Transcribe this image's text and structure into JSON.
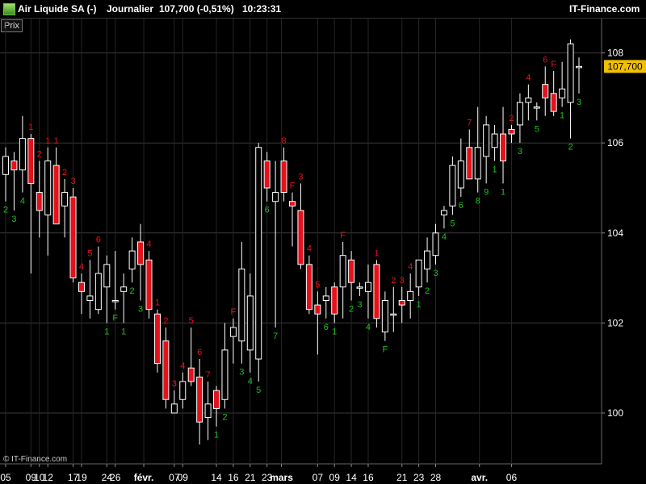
{
  "header": {
    "instrument": "Air Liquide SA (-)",
    "period": "Journalier",
    "price_change": "107,700 (-0,51%)",
    "time": "10:23:31",
    "brand": "IT-Finance.com"
  },
  "panel_label": "Prix",
  "copyright": "© IT-Finance.com",
  "colors": {
    "up": "#ffffff",
    "down": "#e4121b",
    "grid": "#3a3a3a",
    "label_up": "#1fbf1f",
    "label_down": "#e4121b",
    "last_price_bg": "#f0c000"
  },
  "chart_data": {
    "type": "candlestick",
    "y_range": [
      99.0,
      109.0
    ],
    "y_ticks": [
      "100",
      "102",
      "104",
      "106",
      "108"
    ],
    "last_price": "107,700",
    "x_ticks": [
      "05",
      "09",
      "10",
      "12",
      "17",
      "19",
      "24",
      "26",
      "févr.",
      "07",
      "09",
      "14",
      "16",
      "21",
      "23",
      "mars",
      "07",
      "09",
      "14",
      "16",
      "21",
      "23",
      "28",
      "avr.",
      "06"
    ],
    "candles": [
      {
        "o": 105.3,
        "h": 105.9,
        "l": 104.7,
        "c": 105.7,
        "label": "2",
        "lc": "up"
      },
      {
        "o": 105.6,
        "h": 105.8,
        "l": 104.5,
        "c": 105.4,
        "label": "3",
        "lc": "up"
      },
      {
        "o": 105.4,
        "h": 106.6,
        "l": 104.9,
        "c": 106.1,
        "label": "4",
        "lc": "up"
      },
      {
        "o": 106.1,
        "h": 106.2,
        "l": 103.1,
        "c": 105.1,
        "label": "1",
        "lc": "down"
      },
      {
        "o": 104.9,
        "h": 105.6,
        "l": 103.9,
        "c": 104.5,
        "label": "2",
        "lc": "down"
      },
      {
        "o": 104.4,
        "h": 105.9,
        "l": 103.5,
        "c": 105.6,
        "label": "1",
        "lc": "down"
      },
      {
        "o": 105.5,
        "h": 105.9,
        "l": 104.2,
        "c": 104.2,
        "label": "1",
        "lc": "down"
      },
      {
        "o": 104.6,
        "h": 105.2,
        "l": 103.9,
        "c": 104.9,
        "label": "2",
        "lc": "down"
      },
      {
        "o": 104.8,
        "h": 105.0,
        "l": 102.9,
        "c": 103.0,
        "label": "3",
        "lc": "down"
      },
      {
        "o": 102.9,
        "h": 103.1,
        "l": 102.2,
        "c": 102.7,
        "label": "4",
        "lc": "down"
      },
      {
        "o": 102.5,
        "h": 103.4,
        "l": 102.1,
        "c": 102.6,
        "label": "5",
        "lc": "down"
      },
      {
        "o": 102.3,
        "h": 103.7,
        "l": 102.2,
        "c": 103.1,
        "label": "6",
        "lc": "down"
      },
      {
        "o": 102.8,
        "h": 103.5,
        "l": 102.0,
        "c": 103.3,
        "label": "1",
        "lc": "up"
      },
      {
        "o": 102.5,
        "h": 103.6,
        "l": 102.3,
        "c": 102.5,
        "label": "F",
        "lc": "up"
      },
      {
        "o": 102.7,
        "h": 103.1,
        "l": 102.0,
        "c": 102.8,
        "label": "1",
        "lc": "up"
      },
      {
        "o": 103.2,
        "h": 103.9,
        "l": 102.9,
        "c": 103.6,
        "label": "2",
        "lc": "up"
      },
      {
        "o": 103.8,
        "h": 104.2,
        "l": 102.5,
        "c": 103.3,
        "label": "3",
        "lc": "up"
      },
      {
        "o": 103.4,
        "h": 103.6,
        "l": 102.1,
        "c": 102.3,
        "label": "4",
        "lc": "down"
      },
      {
        "o": 102.2,
        "h": 102.3,
        "l": 100.9,
        "c": 101.1,
        "label": "1",
        "lc": "down"
      },
      {
        "o": 101.6,
        "h": 101.9,
        "l": 100.1,
        "c": 100.3,
        "label": "2",
        "lc": "down"
      },
      {
        "o": 100.0,
        "h": 100.5,
        "l": 100.0,
        "c": 100.2,
        "label": "3",
        "lc": "down"
      },
      {
        "o": 100.3,
        "h": 100.9,
        "l": 100.1,
        "c": 100.7,
        "label": "4",
        "lc": "down"
      },
      {
        "o": 101.0,
        "h": 101.9,
        "l": 100.6,
        "c": 100.7,
        "label": "5",
        "lc": "down"
      },
      {
        "o": 100.8,
        "h": 101.2,
        "l": 99.3,
        "c": 99.8,
        "label": "6",
        "lc": "down"
      },
      {
        "o": 99.9,
        "h": 100.7,
        "l": 99.4,
        "c": 100.2,
        "label": "7",
        "lc": "down"
      },
      {
        "o": 100.5,
        "h": 100.6,
        "l": 99.7,
        "c": 100.1,
        "label": "1",
        "lc": "up"
      },
      {
        "o": 100.3,
        "h": 102.0,
        "l": 100.1,
        "c": 101.4,
        "label": "2",
        "lc": "up"
      },
      {
        "o": 101.7,
        "h": 102.1,
        "l": 101.1,
        "c": 101.9,
        "label": "F",
        "lc": "down"
      },
      {
        "o": 101.6,
        "h": 103.8,
        "l": 101.1,
        "c": 103.2,
        "label": "3",
        "lc": "up"
      },
      {
        "o": 101.4,
        "h": 103.1,
        "l": 100.9,
        "c": 102.6,
        "label": "4",
        "lc": "up"
      },
      {
        "o": 101.2,
        "h": 106.0,
        "l": 100.7,
        "c": 105.9,
        "label": "5",
        "lc": "up"
      },
      {
        "o": 105.6,
        "h": 105.8,
        "l": 104.7,
        "c": 105.0,
        "label": "6",
        "lc": "up"
      },
      {
        "o": 104.7,
        "h": 105.6,
        "l": 101.9,
        "c": 104.9,
        "label": "7",
        "lc": "up"
      },
      {
        "o": 105.6,
        "h": 105.9,
        "l": 104.7,
        "c": 104.9,
        "label": "8",
        "lc": "down"
      },
      {
        "o": 104.7,
        "h": 104.9,
        "l": 103.7,
        "c": 104.6,
        "label": "F",
        "lc": "down"
      },
      {
        "o": 104.5,
        "h": 105.1,
        "l": 103.2,
        "c": 103.3,
        "label": "3",
        "lc": "down"
      },
      {
        "o": 103.3,
        "h": 103.5,
        "l": 102.2,
        "c": 102.3,
        "label": "4",
        "lc": "down"
      },
      {
        "o": 102.4,
        "h": 102.7,
        "l": 101.3,
        "c": 102.2,
        "label": "5",
        "lc": "down"
      },
      {
        "o": 102.5,
        "h": 102.8,
        "l": 102.1,
        "c": 102.6,
        "label": "6",
        "lc": "up"
      },
      {
        "o": 102.8,
        "h": 102.9,
        "l": 102.0,
        "c": 102.2,
        "label": "1",
        "lc": "up"
      },
      {
        "o": 102.8,
        "h": 103.8,
        "l": 102.1,
        "c": 103.5,
        "label": "F",
        "lc": "down"
      },
      {
        "o": 103.4,
        "h": 103.6,
        "l": 102.5,
        "c": 102.9,
        "label": "2",
        "lc": "up"
      },
      {
        "o": 102.8,
        "h": 102.9,
        "l": 102.6,
        "c": 102.8,
        "label": "3",
        "lc": "up"
      },
      {
        "o": 102.7,
        "h": 103.3,
        "l": 102.1,
        "c": 102.9,
        "label": "4",
        "lc": "up"
      },
      {
        "o": 103.3,
        "h": 103.4,
        "l": 101.9,
        "c": 102.1,
        "label": "1",
        "lc": "down"
      },
      {
        "o": 101.8,
        "h": 102.7,
        "l": 101.6,
        "c": 102.5,
        "label": "F",
        "lc": "up"
      },
      {
        "o": 102.2,
        "h": 102.8,
        "l": 101.8,
        "c": 102.2,
        "label": "2",
        "lc": "down"
      },
      {
        "o": 102.5,
        "h": 102.8,
        "l": 102.0,
        "c": 102.4,
        "label": "3",
        "lc": "down"
      },
      {
        "o": 102.5,
        "h": 103.1,
        "l": 102.1,
        "c": 102.7,
        "label": "4",
        "lc": "down"
      },
      {
        "o": 102.8,
        "h": 103.4,
        "l": 102.6,
        "c": 103.4,
        "label": "1",
        "lc": "up"
      },
      {
        "o": 103.2,
        "h": 103.9,
        "l": 102.9,
        "c": 103.6,
        "label": "2",
        "lc": "up"
      },
      {
        "o": 103.5,
        "h": 104.2,
        "l": 103.3,
        "c": 104.0,
        "label": "3",
        "lc": "up"
      },
      {
        "o": 104.4,
        "h": 104.6,
        "l": 104.1,
        "c": 104.5,
        "label": "4",
        "lc": "up"
      },
      {
        "o": 104.6,
        "h": 105.7,
        "l": 104.4,
        "c": 105.5,
        "label": "5",
        "lc": "up"
      },
      {
        "o": 105.0,
        "h": 106.1,
        "l": 104.8,
        "c": 105.6,
        "label": "6",
        "lc": "up"
      },
      {
        "o": 105.9,
        "h": 106.3,
        "l": 105.2,
        "c": 105.2,
        "label": "7",
        "lc": "down"
      },
      {
        "o": 105.2,
        "h": 106.8,
        "l": 104.9,
        "c": 105.9,
        "label": "8",
        "lc": "up"
      },
      {
        "o": 105.7,
        "h": 106.6,
        "l": 105.1,
        "c": 106.4,
        "label": "9",
        "lc": "up"
      },
      {
        "o": 105.9,
        "h": 106.4,
        "l": 105.6,
        "c": 106.2,
        "label": "1",
        "lc": "up"
      },
      {
        "o": 106.2,
        "h": 106.8,
        "l": 105.1,
        "c": 105.6,
        "label": "1",
        "lc": "up"
      },
      {
        "o": 106.3,
        "h": 106.4,
        "l": 106.0,
        "c": 106.2,
        "label": "2",
        "lc": "down"
      },
      {
        "o": 106.4,
        "h": 107.1,
        "l": 106.0,
        "c": 106.9,
        "label": "3",
        "lc": "up"
      },
      {
        "o": 106.9,
        "h": 107.3,
        "l": 106.5,
        "c": 107.0,
        "label": "4",
        "lc": "down"
      },
      {
        "o": 106.8,
        "h": 106.9,
        "l": 106.5,
        "c": 106.8,
        "label": "5",
        "lc": "up"
      },
      {
        "o": 107.3,
        "h": 107.7,
        "l": 106.6,
        "c": 107.0,
        "label": "6",
        "lc": "down"
      },
      {
        "o": 107.1,
        "h": 107.6,
        "l": 106.6,
        "c": 106.7,
        "label": "F",
        "lc": "down"
      },
      {
        "o": 107.0,
        "h": 107.8,
        "l": 106.8,
        "c": 107.2,
        "label": "1",
        "lc": "up"
      },
      {
        "o": 106.9,
        "h": 108.3,
        "l": 106.1,
        "c": 108.2,
        "label": "2",
        "lc": "up"
      },
      {
        "o": 107.7,
        "h": 107.9,
        "l": 107.1,
        "c": 107.7,
        "label": "3",
        "lc": "up"
      }
    ]
  }
}
